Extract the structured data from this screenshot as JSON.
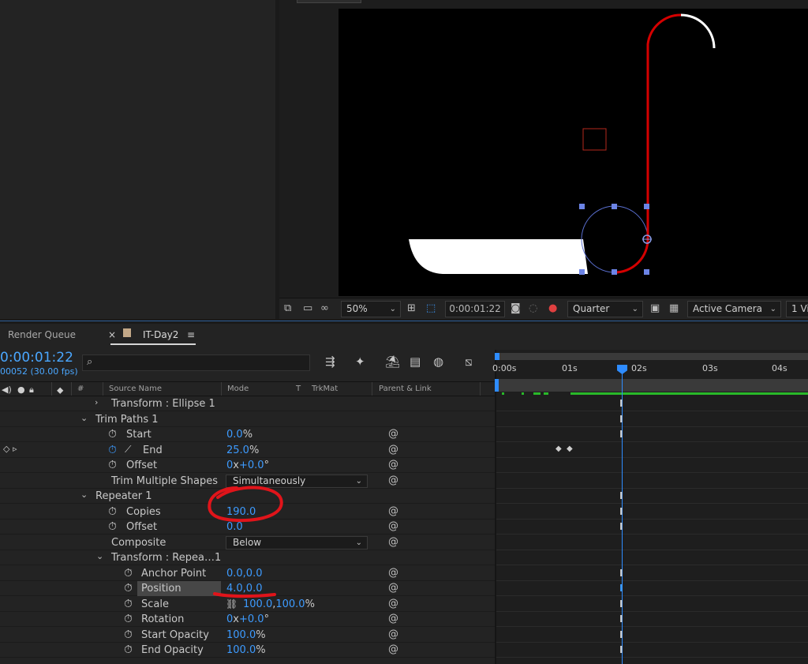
{
  "viewer": {
    "zoom": "50%",
    "timecode": "0:00:01:22",
    "resolution": "Quarter",
    "camera": "Active Camera",
    "views": "1 Vi"
  },
  "timeline": {
    "tabs": {
      "render_queue": "Render Queue",
      "comp": "IT-Day2",
      "close": "×",
      "menu": "≡"
    },
    "timecode": "0:00:01:22",
    "fps": "00052 (30.00 fps)",
    "search_placeholder": "",
    "columns": {
      "hash": "#",
      "source_name": "Source Name",
      "mode": "Mode",
      "t": "T",
      "trkmat": "TrkMat",
      "parent": "Parent & Link"
    },
    "ruler": [
      "0:00s",
      "01s",
      "02s",
      "03s",
      "04s"
    ]
  },
  "props": {
    "transform_ellipse": "Transform : Ellipse 1",
    "trim_paths": "Trim Paths 1",
    "start": {
      "label": "Start",
      "value": "0.0",
      "unit": "%"
    },
    "end": {
      "label": "End",
      "value": "25.0",
      "unit": "%"
    },
    "offset_trim": {
      "label": "Offset",
      "rev": "0",
      "x": "x",
      "deg": "+0.0",
      "unit": "°"
    },
    "trim_multiple": {
      "label": "Trim Multiple Shapes",
      "value": "Simultaneously"
    },
    "repeater": "Repeater 1",
    "copies": {
      "label": "Copies",
      "value": "190.0"
    },
    "offset_rep": {
      "label": "Offset",
      "value": "0.0"
    },
    "composite": {
      "label": "Composite",
      "value": "Below"
    },
    "transform_repeater": "Transform : Repea…1",
    "anchor": {
      "label": "Anchor Point",
      "value": "0.0,0.0"
    },
    "position": {
      "label": "Position",
      "value": "4.0,0.0"
    },
    "scale": {
      "label": "Scale",
      "x": "100.0",
      "y": "100.0",
      "unit": "%"
    },
    "rotation": {
      "label": "Rotation",
      "rev": "0",
      "x": "x",
      "deg": "+0.0",
      "unit": "°"
    },
    "start_opacity": {
      "label": "Start Opacity",
      "value": "100.0",
      "unit": "%"
    },
    "end_opacity": {
      "label": "End Opacity",
      "value": "100.0",
      "unit": "%"
    }
  },
  "colors": {
    "accent": "#3d9bff",
    "annotation": "#e0141a",
    "path_red": "#d40000"
  }
}
